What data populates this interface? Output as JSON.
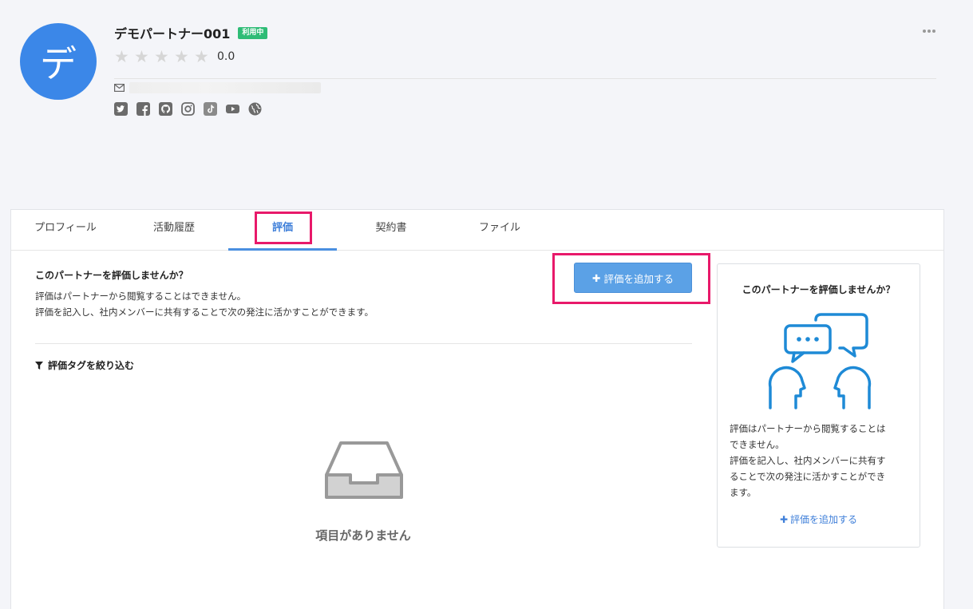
{
  "profile": {
    "avatar_initial": "デ",
    "name": "デモパートナー001",
    "status_badge": "利用中",
    "rating_value": "0.0",
    "rating_stars": 0,
    "social_icons": [
      "twitter-icon",
      "facebook-icon",
      "github-icon",
      "instagram-icon",
      "tiktok-icon",
      "youtube-icon",
      "website-icon"
    ]
  },
  "tabs": [
    {
      "label": "プロフィール"
    },
    {
      "label": "活動履歴"
    },
    {
      "label": "評価"
    },
    {
      "label": "契約書"
    },
    {
      "label": "ファイル"
    }
  ],
  "active_tab": "評価",
  "main": {
    "prompt_title": "このパートナーを評価しませんか？",
    "prompt_line1": "評価はパートナーから閲覧することはできません。",
    "prompt_line2": "評価を記入し、社内メンバーに共有することで次の発注に活かすことができます。",
    "add_button_label": "評価を追加する",
    "filter_label": "評価タグを絞り込む",
    "empty_text": "項目がありません"
  },
  "side": {
    "title": "このパートナーを評価しませんか？",
    "text_line1": "評価はパートナーから閲覧することは",
    "text_line2": "できません。",
    "text_line3": "評価を記入し、社内メンバーに共有す",
    "text_line4": "ることで次の発注に活かすことができ",
    "text_line5": "ます。",
    "link_label": "評価を追加する"
  },
  "colors": {
    "accent": "#3b87e8",
    "badge": "#2ebc76",
    "highlight": "#e8196a",
    "button": "#5ba1e6"
  }
}
